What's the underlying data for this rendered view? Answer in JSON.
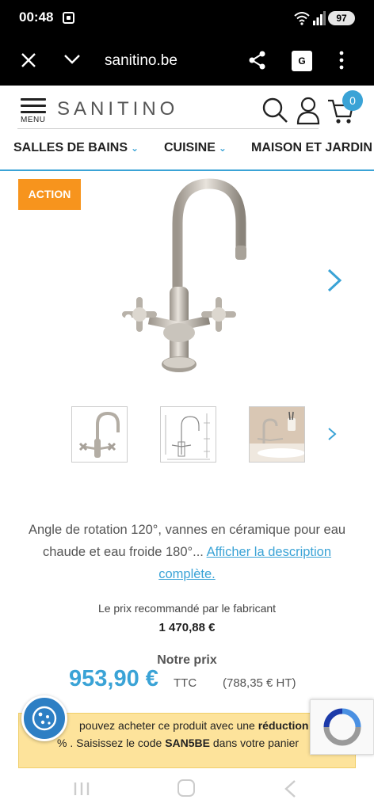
{
  "status_bar": {
    "time": "00:48",
    "battery": "97"
  },
  "browser": {
    "url": "sanitino.be"
  },
  "header": {
    "menu_label": "MENU",
    "logo": "SANITINO",
    "cart_count": "0"
  },
  "nav": {
    "items": [
      {
        "label": "SALLES DE BAINS"
      },
      {
        "label": "CUISINE"
      },
      {
        "label": "MAISON ET JARDIN"
      }
    ]
  },
  "product": {
    "badge": "ACTION",
    "description_text": "Angle de rotation 120°, vannes en céramique pour eau chaude et eau froide 180°...",
    "description_link": "Afficher la description complète."
  },
  "pricing": {
    "recommended_label": "Le prix recommandé par le fabricant",
    "recommended_price": "1 470,88 €",
    "our_price_label": "Notre prix",
    "our_price": "953,90 €",
    "ttc": "TTC",
    "ht": "(788,35 € HT)"
  },
  "promo": {
    "text_1": "pouvez acheter ce produit avec une",
    "bold_1": "réduction",
    "text_2": "% . Saisissez le code",
    "code": "SAN5BE",
    "text_3": "dans votre panier"
  },
  "colors": {
    "accent": "#3aa3d6",
    "badge": "#f7941d",
    "promo_bg": "#fde39b"
  }
}
